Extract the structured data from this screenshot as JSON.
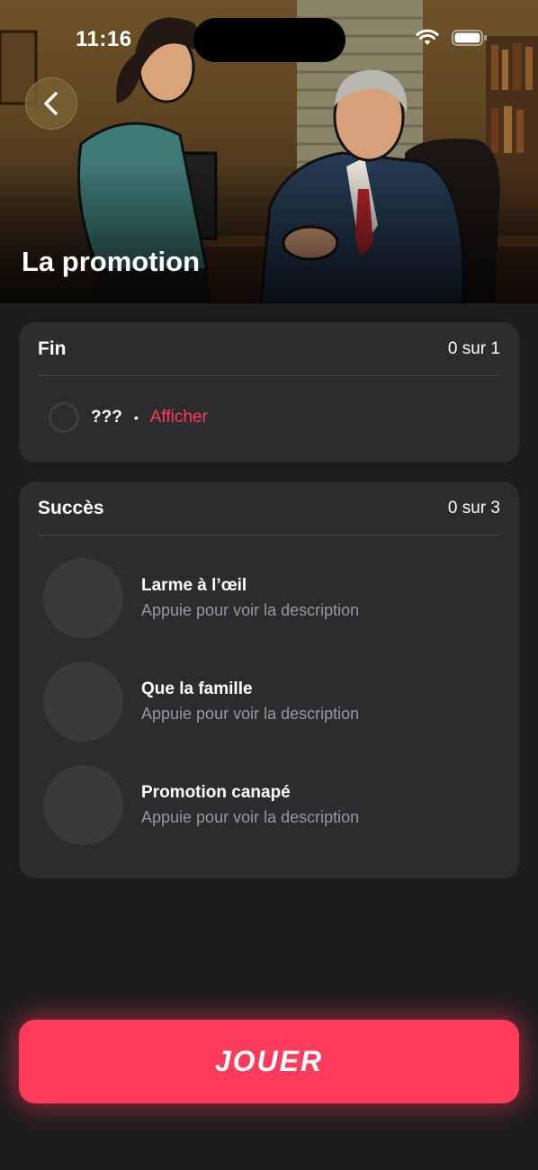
{
  "status_bar": {
    "time": "11:16"
  },
  "hero": {
    "title": "La promotion",
    "image_description_icon": "office-scene-illustration"
  },
  "back_button": {
    "icon": "chevron-left-icon"
  },
  "endings": {
    "title": "Fin",
    "count": "0 sur 1",
    "items": [
      {
        "name": "???",
        "separator": "•",
        "action": "Afficher"
      }
    ]
  },
  "achievements": {
    "title": "Succès",
    "count": "0 sur 3",
    "items": [
      {
        "title": "Larme à l’œil",
        "subtitle": "Appuie pour voir la description"
      },
      {
        "title": "Que la famille",
        "subtitle": "Appuie pour voir la description"
      },
      {
        "title": "Promotion canapé",
        "subtitle": "Appuie pour voir la description"
      }
    ]
  },
  "play_button": {
    "label": "JOUER"
  },
  "colors": {
    "accent": "#ff3b5c",
    "background": "#1c1c1e",
    "card": "#2c2c2e",
    "secondary_text": "#98989d"
  }
}
